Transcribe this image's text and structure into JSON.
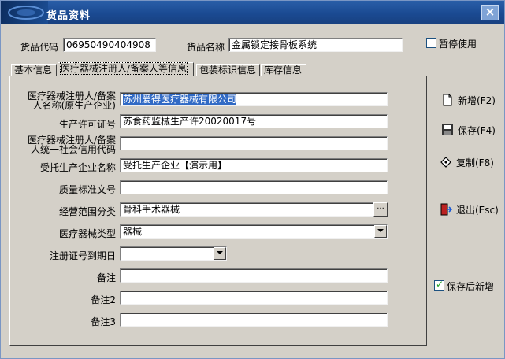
{
  "window": {
    "title": "货品资料",
    "close_glyph": "×"
  },
  "header": {
    "code_label": "货品代码",
    "code_value": "06950490404908",
    "name_label": "货品名称",
    "name_value": "金属锁定接骨板系统",
    "suspend_label": "暂停使用",
    "suspend_checked": false
  },
  "tabs": [
    {
      "label": "基本信息"
    },
    {
      "label": "医疗器械注册人/备案人等信息",
      "active": true
    },
    {
      "label": "包装标识信息"
    },
    {
      "label": "库存信息"
    }
  ],
  "form": {
    "registrant_label_1": "医疗器械注册人/备案",
    "registrant_label_2": "人名称(原生产企业)",
    "registrant_value": "苏州爱得医疗器械有限公司",
    "license_label": "生产许可证号",
    "license_value": "苏食药监械生产许20020017号",
    "credit_label_1": "医疗器械注册人/备案",
    "credit_label_2": "人统一社会信用代码",
    "credit_value": "",
    "entrusted_label": "受托生产企业名称",
    "entrusted_value": "受托生产企业【演示用】",
    "quality_label": "质量标准文号",
    "quality_value": "",
    "scope_label": "经营范围分类",
    "scope_value": "骨科手术器械",
    "scope_btn": "···",
    "device_type_label": "医疗器械类型",
    "device_type_value": "器械",
    "expiry_label": "注册证号到期日",
    "expiry_value": "-   -",
    "note_label": "备注",
    "note_value": "",
    "note2_label": "备注2",
    "note2_value": "",
    "note3_label": "备注3",
    "note3_value": ""
  },
  "side": {
    "new_label": "新增(F2)",
    "save_label": "保存(F4)",
    "copy_label": "复制(F8)",
    "exit_label": "退出(Esc)",
    "save_new_label": "保存后新增",
    "save_new_checked": true
  },
  "icons": {
    "new": "new-document-icon",
    "save": "floppy-disk-icon",
    "copy": "copy-icon",
    "exit": "exit-door-icon",
    "dropdown": "dropdown-arrow-icon"
  }
}
